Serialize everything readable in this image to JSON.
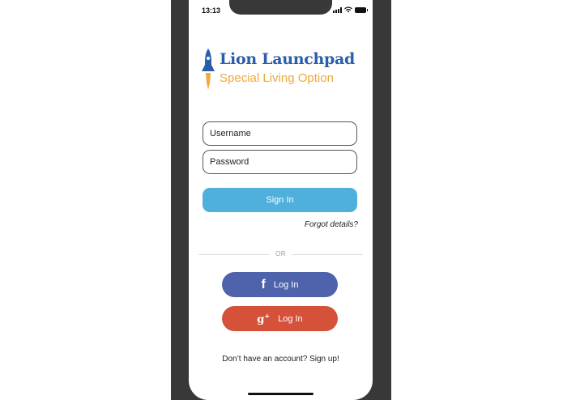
{
  "status_bar": {
    "time": "13:13"
  },
  "logo": {
    "title": "Lion Launchpad",
    "subtitle": "Special Living Option"
  },
  "form": {
    "username_placeholder": "Username",
    "password_placeholder": "Password",
    "sign_in_label": "Sign In",
    "forgot_label": "Forgot details?"
  },
  "divider": {
    "label": "OR"
  },
  "social": {
    "facebook": {
      "icon": "facebook-icon",
      "label": "Log In",
      "color": "#4f63ad"
    },
    "google": {
      "icon": "google-plus-icon",
      "label": "Log In",
      "color": "#d5513a"
    }
  },
  "footer": {
    "signup_text": "Don’t have an account? Sign up!"
  },
  "colors": {
    "primary_button": "#4fb0de",
    "brand_blue": "#2a5ea8",
    "brand_orange": "#f0a936"
  }
}
